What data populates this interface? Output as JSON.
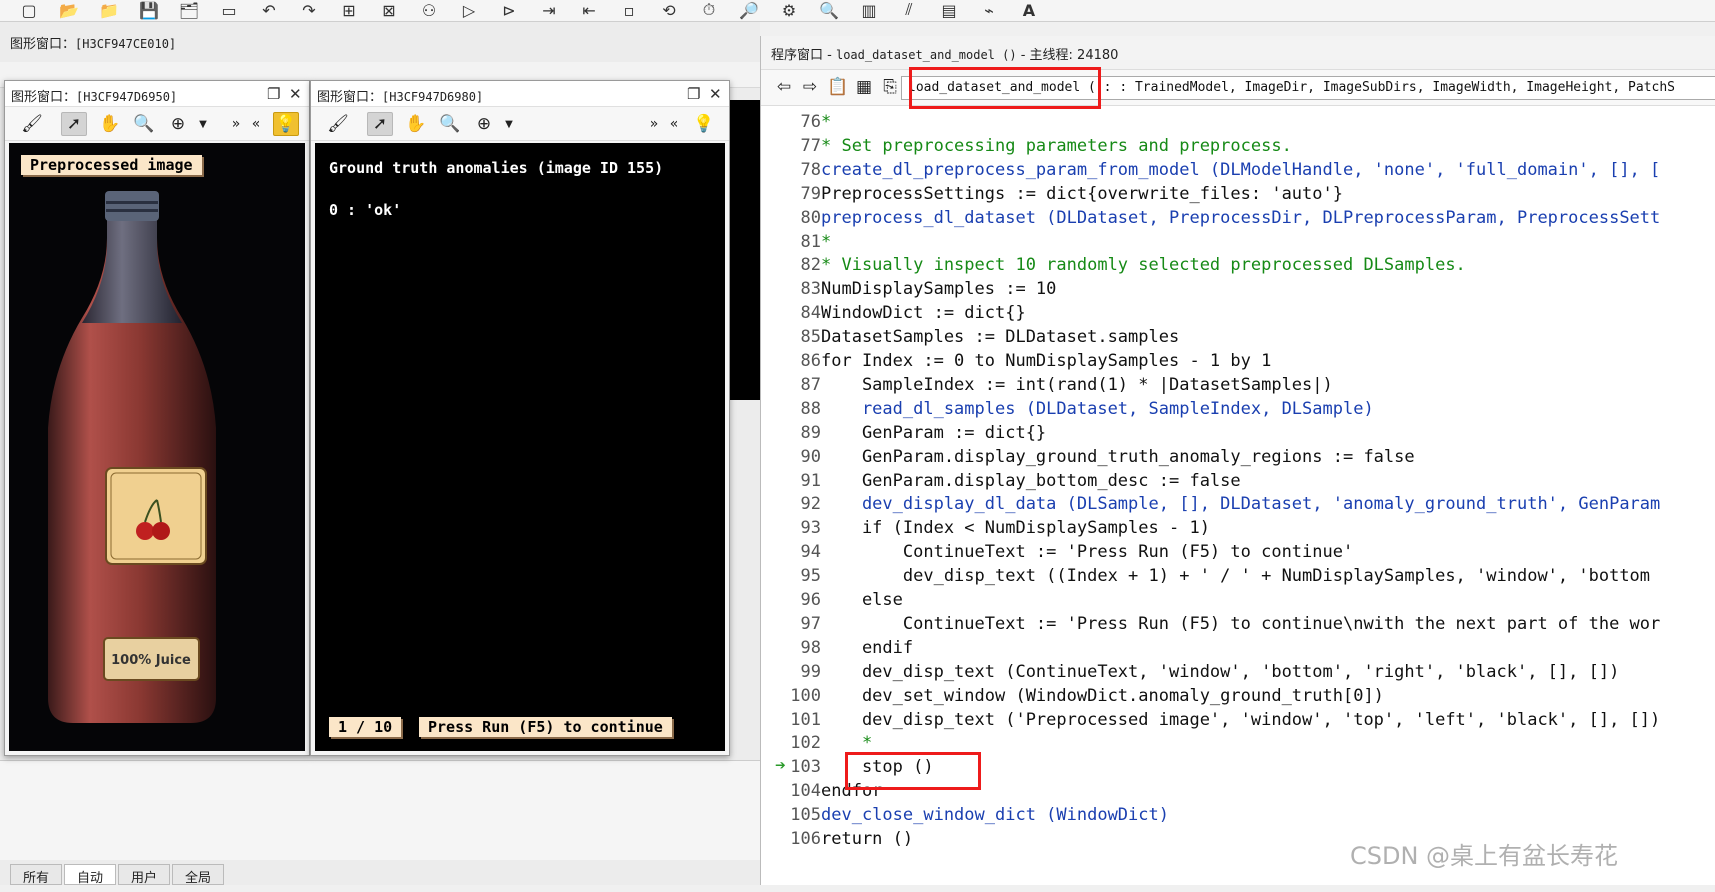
{
  "toolbar": {
    "icons": [
      "new-file-icon",
      "open-icon",
      "open-folder-icon",
      "save-icon",
      "save-all-icon",
      "window-icon",
      "undo-icon",
      "redo-icon",
      "insert-icon",
      "delete-icon",
      "binoculars-icon",
      "run-icon",
      "step-over-icon",
      "step-into-icon",
      "step-out-icon",
      "stop-icon",
      "reset-icon",
      "profile-icon",
      "inspect-icon",
      "assistant-icon",
      "zoom-icon",
      "histogram-icon",
      "line-profile-icon",
      "gray-icon",
      "feature-icon",
      "font-icon"
    ],
    "font_label": "A"
  },
  "main_graphics_window": {
    "title_label": "图形窗口：",
    "title_id": "[H3CF947CE010]"
  },
  "graphics_window_1": {
    "title_label": "图形窗口：",
    "title_id": "[H3CF947D6950]",
    "heading": "Preprocessed image",
    "label_text": "100% Juice"
  },
  "graphics_window_2": {
    "title_label": "图形窗口：",
    "title_id": "[H3CF947D6980]",
    "heading": "Ground truth anomalies (image ID 155)",
    "class_line": "0 : 'ok'",
    "counter": "1 / 10",
    "continue_text": "Press Run (F5) to continue"
  },
  "program_window": {
    "title_label": "程序窗口 - ",
    "title_proc": "load_dataset_and_model ()",
    "title_thread": " - 主线程: 24180",
    "proc_combo": "load_dataset_and_model ( : : TrainedModel, ImageDir, ImageSubDirs, ImageWidth, ImageHeight, PatchS",
    "current_line": "103",
    "lines": [
      {
        "n": "76",
        "text": "*",
        "kind": "comment"
      },
      {
        "n": "77",
        "text": "* Set preprocessing parameters and preprocess.",
        "kind": "comment"
      },
      {
        "n": "78",
        "text": "create_dl_preprocess_param_from_model (DLModelHandle, 'none', 'full_domain', [], [",
        "kind": "proc"
      },
      {
        "n": "79",
        "text": "PreprocessSettings := dict{overwrite_files: 'auto'}",
        "kind": "normal"
      },
      {
        "n": "80",
        "text": "preprocess_dl_dataset (DLDataset, PreprocessDir, DLPreprocessParam, PreprocessSett",
        "kind": "proc"
      },
      {
        "n": "81",
        "text": "*",
        "kind": "comment"
      },
      {
        "n": "82",
        "text": "* Visually inspect 10 randomly selected preprocessed DLSamples.",
        "kind": "comment"
      },
      {
        "n": "83",
        "text": "NumDisplaySamples := 10",
        "kind": "normal"
      },
      {
        "n": "84",
        "text": "WindowDict := dict{}",
        "kind": "normal"
      },
      {
        "n": "85",
        "text": "DatasetSamples := DLDataset.samples",
        "kind": "normal"
      },
      {
        "n": "86",
        "text": "for Index := 0 to NumDisplaySamples - 1 by 1",
        "kind": "normal"
      },
      {
        "n": "87",
        "text": "    SampleIndex := int(rand(1) * |DatasetSamples|)",
        "kind": "normal"
      },
      {
        "n": "88",
        "text": "    read_dl_samples (DLDataset, SampleIndex, DLSample)",
        "kind": "proc"
      },
      {
        "n": "89",
        "text": "    GenParam := dict{}",
        "kind": "normal"
      },
      {
        "n": "90",
        "text": "    GenParam.display_ground_truth_anomaly_regions := false",
        "kind": "normal"
      },
      {
        "n": "91",
        "text": "    GenParam.display_bottom_desc := false",
        "kind": "normal"
      },
      {
        "n": "92",
        "text": "    dev_display_dl_data (DLSample, [], DLDataset, 'anomaly_ground_truth', GenParam",
        "kind": "proc"
      },
      {
        "n": "93",
        "text": "    if (Index < NumDisplaySamples - 1)",
        "kind": "normal"
      },
      {
        "n": "94",
        "text": "        ContinueText := 'Press Run (F5) to continue'",
        "kind": "normal"
      },
      {
        "n": "95",
        "text": "        dev_disp_text ((Index + 1) + ' / ' + NumDisplaySamples, 'window', 'bottom",
        "kind": "normal"
      },
      {
        "n": "96",
        "text": "    else",
        "kind": "normal"
      },
      {
        "n": "97",
        "text": "        ContinueText := 'Press Run (F5) to continue\\nwith the next part of the wor",
        "kind": "normal"
      },
      {
        "n": "98",
        "text": "    endif",
        "kind": "normal"
      },
      {
        "n": "99",
        "text": "    dev_disp_text (ContinueText, 'window', 'bottom', 'right', 'black', [], [])",
        "kind": "normal"
      },
      {
        "n": "100",
        "text": "    dev_set_window (WindowDict.anomaly_ground_truth[0])",
        "kind": "normal"
      },
      {
        "n": "101",
        "text": "    dev_disp_text ('Preprocessed image', 'window', 'top', 'left', 'black', [], [])",
        "kind": "normal"
      },
      {
        "n": "102",
        "text": "    *",
        "kind": "comment"
      },
      {
        "n": "103",
        "text": "    stop ()",
        "kind": "normal"
      },
      {
        "n": "104",
        "text": "endfor",
        "kind": "normal"
      },
      {
        "n": "105",
        "text": "dev_close_window_dict (WindowDict)",
        "kind": "proc"
      },
      {
        "n": "106",
        "text": "return ()",
        "kind": "normal"
      }
    ]
  },
  "bottom_tabs": [
    "所有",
    "自动",
    "用户",
    "全局"
  ],
  "watermark": "CSDN @桌上有盆长寿花",
  "colors": {
    "comment": "#168a16",
    "procedure": "#1a3fb0",
    "highlight_box": "#ee1b1b",
    "label_bg": "#fbe6c8"
  }
}
